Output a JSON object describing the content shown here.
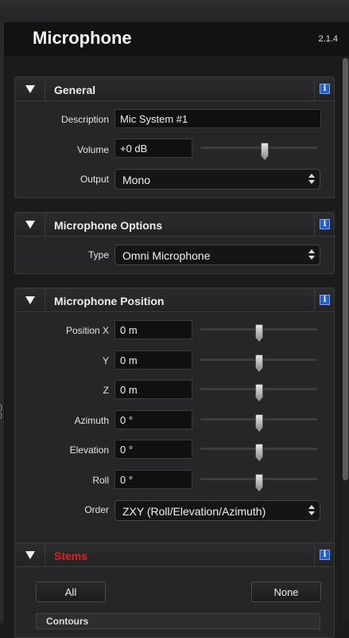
{
  "header": {
    "title": "Microphone",
    "version": "2.1.4"
  },
  "info_glyph": "i",
  "general": {
    "title": "General",
    "description": {
      "label": "Description",
      "value": "Mic System #1"
    },
    "volume": {
      "label": "Volume",
      "value": "+0 dB",
      "slider_level": 0.55
    },
    "output": {
      "label": "Output",
      "value": "Mono"
    }
  },
  "mic_options": {
    "title": "Microphone Options",
    "type": {
      "label": "Type",
      "value": "Omni Microphone"
    }
  },
  "mic_position": {
    "title": "Microphone Position",
    "rows": [
      {
        "label": "Position X",
        "value": "0 m",
        "slider_level": 0.5
      },
      {
        "label": "Y",
        "value": "0 m",
        "slider_level": 0.5
      },
      {
        "label": "Z",
        "value": "0 m",
        "slider_level": 0.5
      },
      {
        "label": "Azimuth",
        "value": "0 °",
        "slider_level": 0.5
      },
      {
        "label": "Elevation",
        "value": "0 °",
        "slider_level": 0.5
      },
      {
        "label": "Roll",
        "value": "0 °",
        "slider_level": 0.5
      }
    ],
    "order": {
      "label": "Order",
      "value": "ZXY (Roll/Elevation/Azimuth)"
    }
  },
  "stems": {
    "title": "Stems",
    "title_color": "#e31e24",
    "all_label": "All",
    "none_label": "None",
    "sub_label": "Contours"
  },
  "colors": {
    "info_blue": "#1f5fd6",
    "stems_red": "#e31e24"
  }
}
